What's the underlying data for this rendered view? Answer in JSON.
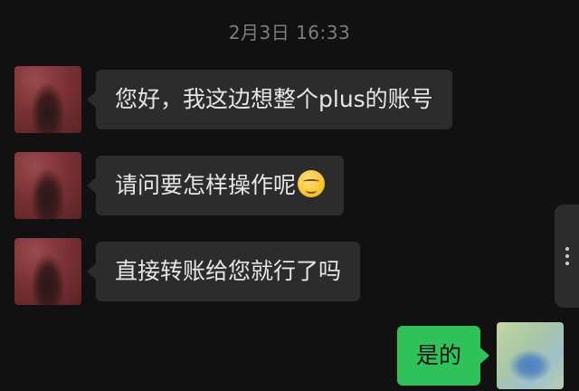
{
  "chat": {
    "timestamp": "2月3日 16:33",
    "messages": [
      {
        "side": "in",
        "text": "您好，我这边想整个plus的账号"
      },
      {
        "side": "in",
        "text": "请问要怎样操作呢",
        "emoji": "thinking-face-emoji"
      },
      {
        "side": "in",
        "text": "直接转账给您就行了吗"
      },
      {
        "side": "out",
        "text": "是的"
      }
    ]
  },
  "colors": {
    "background": "#111111",
    "incoming_bubble": "#2c2c2c",
    "outgoing_bubble": "#2fc25b",
    "timestamp": "#7d7d7d"
  },
  "icons": {
    "side_handle": "more-dots-icon"
  }
}
